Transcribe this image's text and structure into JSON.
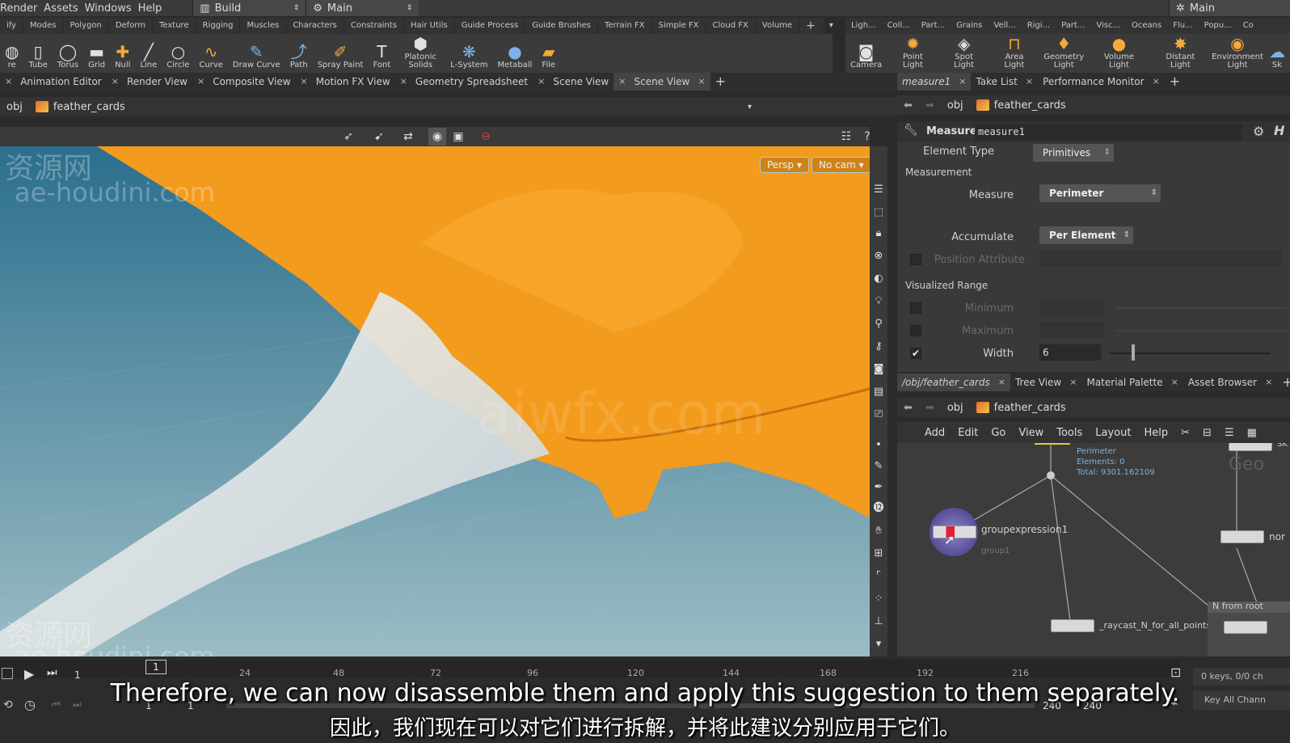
{
  "menubar": {
    "items": [
      "Render",
      "Assets",
      "Windows",
      "Help"
    ],
    "desktop_selector": "Build",
    "context_selector": "Main",
    "right_selector": "Main"
  },
  "shelf_tabs": [
    "ify",
    "Modes",
    "Polygon",
    "Deform",
    "Texture",
    "Rigging",
    "Muscles",
    "Characters",
    "Constraints",
    "Hair Utils",
    "Guide Process",
    "Guide Brushes",
    "Terrain FX",
    "Simple FX",
    "Cloud FX",
    "Volume"
  ],
  "shelf_tabs_right": [
    "Ligh...",
    "Coll...",
    "Part...",
    "Grains",
    "Vell...",
    "Rigi...",
    "Part...",
    "Visc...",
    "Oceans",
    "Flu...",
    "Popu...",
    "Co"
  ],
  "tools": [
    "re",
    "Tube",
    "Torus",
    "Grid",
    "Null",
    "Line",
    "Circle",
    "Curve",
    "Draw Curve",
    "Path",
    "Spray Paint",
    "Font",
    "Platonic Solids",
    "L-System",
    "Metaball",
    "File"
  ],
  "tools_right": [
    "Camera",
    "Point Light",
    "Spot Light",
    "Area Light",
    "Geometry Light",
    "Volume Light",
    "Distant Light",
    "Environment Light",
    "Sk"
  ],
  "pane_tabs": [
    "Animation Editor",
    "Render View",
    "Composite View",
    "Motion FX View",
    "Geometry Spreadsheet",
    "Scene View",
    "Scene View"
  ],
  "path": {
    "root": "obj",
    "node": "feather_cards"
  },
  "viewport": {
    "persp": "Persp",
    "cam": "No cam",
    "watermark_cn": "资源网",
    "watermark_url": "ae-houdini.com",
    "watermark_center": "aiwfx.com"
  },
  "right_tabs": [
    "measure1",
    "Take List",
    "Performance Monitor"
  ],
  "params": {
    "node_type": "Measure",
    "node_name": "measure1",
    "element_type_label": "Element Type",
    "element_type": "Primitives",
    "measurement_section": "Measurement",
    "measure_label": "Measure",
    "measure_value": "Perimeter",
    "accumulate_label": "Accumulate",
    "accumulate_value": "Per Element",
    "position_attr_label": "Position Attribute",
    "visualized_section": "Visualized Range",
    "minimum_label": "Minimum",
    "maximum_label": "Maximum",
    "width_label": "Width",
    "width_value": "6"
  },
  "network_tabs": [
    "/obj/feather_cards",
    "Tree View",
    "Material Palette",
    "Asset Browser"
  ],
  "network_menu": [
    "Add",
    "Edit",
    "Go",
    "View",
    "Tools",
    "Layout",
    "Help"
  ],
  "network": {
    "info_lines": [
      "Perimeter",
      "Elements: 0",
      "Total: 9301.162109"
    ],
    "node_groupexpr": "groupexpression1",
    "node_groupexpr_sub": "group1",
    "node_raycast": "_raycast_N_for_all_points",
    "node_nor": "nor",
    "netbox": "N from root",
    "geo_label": "Geo",
    "sk_label": "SK"
  },
  "timeline": {
    "ticks": [
      "24",
      "48",
      "72",
      "96",
      "120",
      "144",
      "168",
      "192",
      "216"
    ],
    "frame": "1",
    "start": "1",
    "start2": "1",
    "end": "240",
    "end2": "240",
    "keys": "0 keys, 0/0 ch",
    "key_all": "Key All Chann"
  },
  "subtitles": {
    "en": "Therefore, we can now disassemble them and apply this suggestion to them separately.",
    "cn": "因此，我们现在可以对它们进行拆解，并将此建议分别应用于它们。"
  }
}
